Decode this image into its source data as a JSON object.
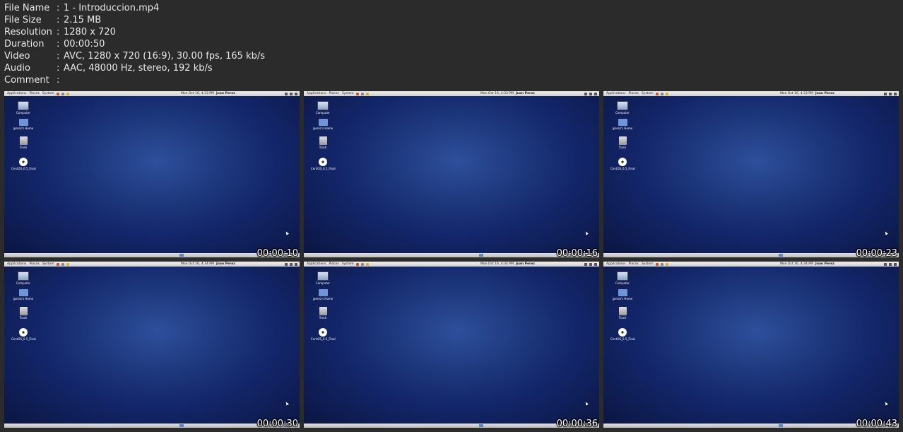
{
  "meta": [
    {
      "key": "File Name",
      "value": "1 - Introduccion.mp4"
    },
    {
      "key": "File Size",
      "value": "2.15 MB"
    },
    {
      "key": "Resolution",
      "value": "1280 x 720"
    },
    {
      "key": "Duration",
      "value": "00:00:50"
    },
    {
      "key": "Video",
      "value": "AVC, 1280 x 720 (16:9), 30.00 fps, 165 kb/s"
    },
    {
      "key": "Audio",
      "value": "AAC, 48000 Hz, stereo, 192 kb/s"
    },
    {
      "key": "Comment",
      "value": ""
    }
  ],
  "separator": ":",
  "desktop": {
    "menus": [
      "Applications",
      "Places",
      "System"
    ],
    "user": "Juan Perez",
    "icons": [
      {
        "label": "Computer",
        "icon": "computer-icon"
      },
      {
        "label": "jperez's Home",
        "icon": "home-folder-icon"
      },
      {
        "label": "Trash",
        "icon": "trash-icon"
      },
      {
        "label": "CentOS_6.5_Final",
        "icon": "disc-icon"
      }
    ]
  },
  "thumbnails": [
    {
      "timestamp": "00:00:10",
      "clock": "Mon Oct 16, 4:33 PM"
    },
    {
      "timestamp": "00:00:16",
      "clock": "Mon Oct 16, 4:33 PM"
    },
    {
      "timestamp": "00:00:23",
      "clock": "Mon Oct 16, 4:33 PM"
    },
    {
      "timestamp": "00:00:30",
      "clock": "Mon Oct 16, 4:34 PM"
    },
    {
      "timestamp": "00:00:36",
      "clock": "Mon Oct 16, 4:34 PM"
    },
    {
      "timestamp": "00:00:43",
      "clock": "Mon Oct 16, 4:34 PM"
    }
  ]
}
